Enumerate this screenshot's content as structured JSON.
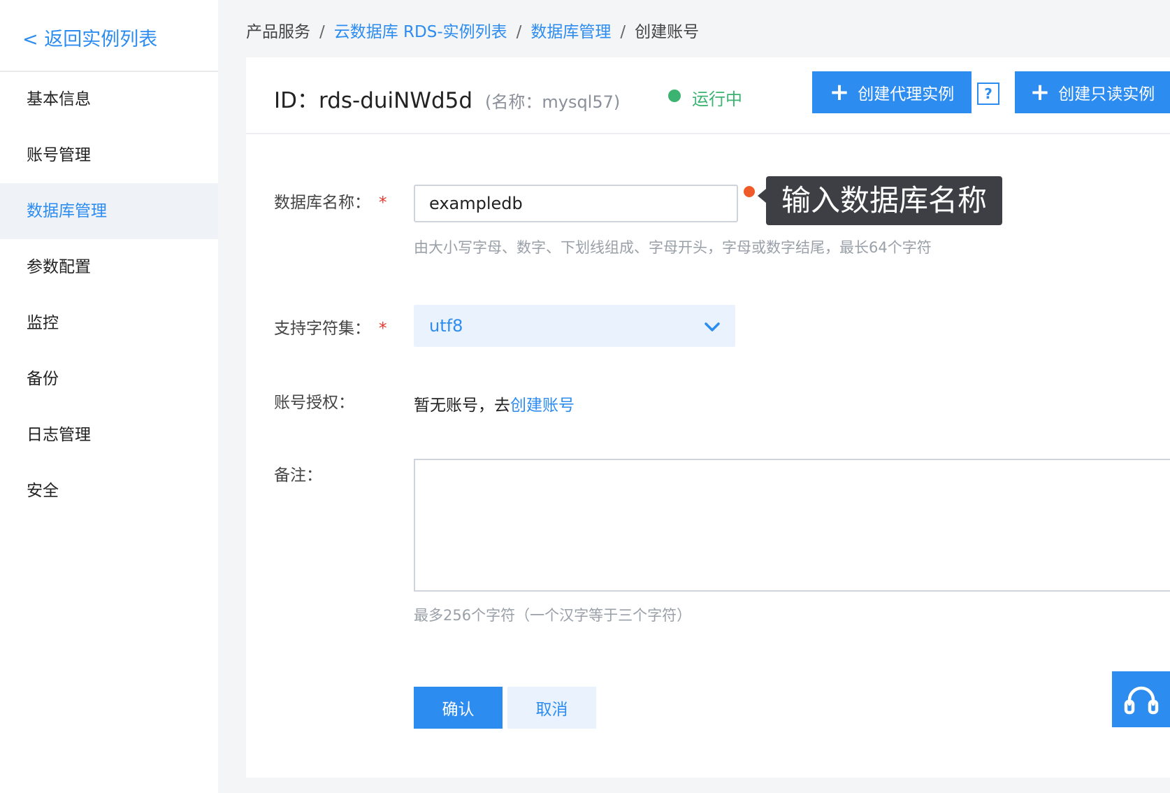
{
  "sidebar": {
    "back_label": "< 返回实例列表",
    "items": [
      {
        "label": "基本信息",
        "active": false
      },
      {
        "label": "账号管理",
        "active": false
      },
      {
        "label": "数据库管理",
        "active": true
      },
      {
        "label": "参数配置",
        "active": false
      },
      {
        "label": "监控",
        "active": false
      },
      {
        "label": "备份",
        "active": false
      },
      {
        "label": "日志管理",
        "active": false
      },
      {
        "label": "安全",
        "active": false
      }
    ]
  },
  "breadcrumb": {
    "root": "产品服务",
    "separator": "/",
    "instance_list": "云数据库 RDS-实例列表",
    "db_manage": "数据库管理",
    "current": "创建账号"
  },
  "header": {
    "instance_id": "ID：rds-duiNWd5d",
    "instance_name": "(名称：mysql57)",
    "status": "运行中",
    "create_proxy_label": "创建代理实例",
    "help_label": "?",
    "create_readonly_label": "创建只读实例"
  },
  "form": {
    "db_name_label": "数据库名称：",
    "required_mark": "*",
    "db_name_value": "exampledb",
    "db_name_tooltip": "输入数据库名称",
    "db_name_hint": "由大小写字母、数字、下划线组成、字母开头，字母或数字结尾，最长64个字符",
    "charset_label": "支持字符集：",
    "charset_value": "utf8",
    "auth_label": "账号授权：",
    "auth_text": "暂无账号，去",
    "auth_link": "创建账号",
    "remark_label": "备注：",
    "remark_value": "",
    "remark_hint": "最多256个字符（一个汉字等于三个字符）",
    "confirm_label": "确认",
    "cancel_label": "取消"
  },
  "colors": {
    "accent": "#2d8cf0",
    "status_running": "#3cb371",
    "error": "#f05a28",
    "required": "#e6362b"
  },
  "icons": {
    "plus": "plus-icon",
    "chevron": "chevron-down-icon",
    "support": "headset-icon"
  }
}
